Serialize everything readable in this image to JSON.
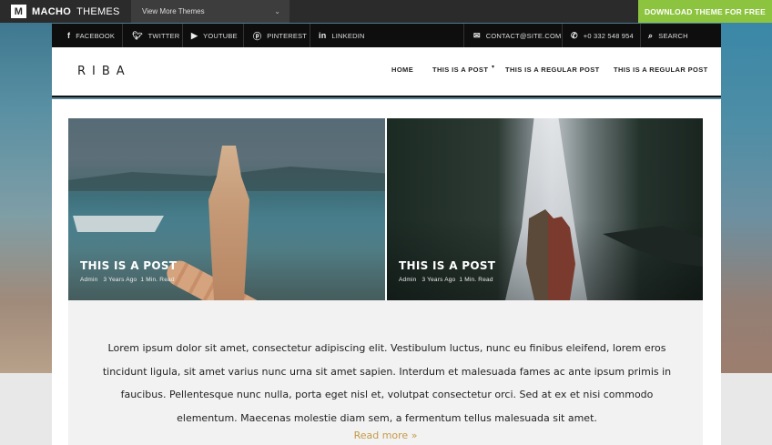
{
  "topbar": {
    "logo_mark": "M",
    "brand_bold": "MACHO",
    "brand_light": "THEMES",
    "theme_select": "View More Themes",
    "download_label": "DOWNLOAD THEME FOR FREE"
  },
  "social": {
    "facebook": "FACEBOOK",
    "twitter": "TWITTER",
    "youtube": "YOUTUBE",
    "pinterest": "PINTEREST",
    "linkedin": "LINKEDIN",
    "email": "CONTACT@SITE.COM",
    "phone": "+0 332 548 954",
    "search": "SEARCH"
  },
  "header": {
    "logo": "RIBA",
    "nav": [
      "HOME",
      "THIS IS A POST",
      "THIS IS A REGULAR POST",
      "THIS IS A REGULAR POST"
    ]
  },
  "posts": [
    {
      "title": "THIS IS A POST",
      "author": "Admin",
      "age": "3 Years Ago",
      "read": "1 Min. Read"
    },
    {
      "title": "THIS IS A POST",
      "author": "Admin",
      "age": "3 Years Ago",
      "read": "1 Min. Read"
    }
  ],
  "excerpt": {
    "text": "Lorem ipsum dolor sit amet, consectetur adipiscing elit. Vestibulum luctus, nunc eu finibus eleifend, lorem eros tincidunt ligula, sit amet varius nunc urna sit amet sapien. Interdum et malesuada fames ac ante ipsum primis in faucibus. Pellentesque nunc nulla, porta eget nisl et, volutpat consectetur orci. Sed at ex et nisi commodo elementum. Maecenas molestie diam sem, a fermentum tellus malesuada sit amet.",
    "read_more": "Read more »"
  },
  "colors": {
    "download_green": "#8cc43f",
    "read_more_gold": "#c59a47",
    "social_bar_bg": "#0e0e0e"
  }
}
